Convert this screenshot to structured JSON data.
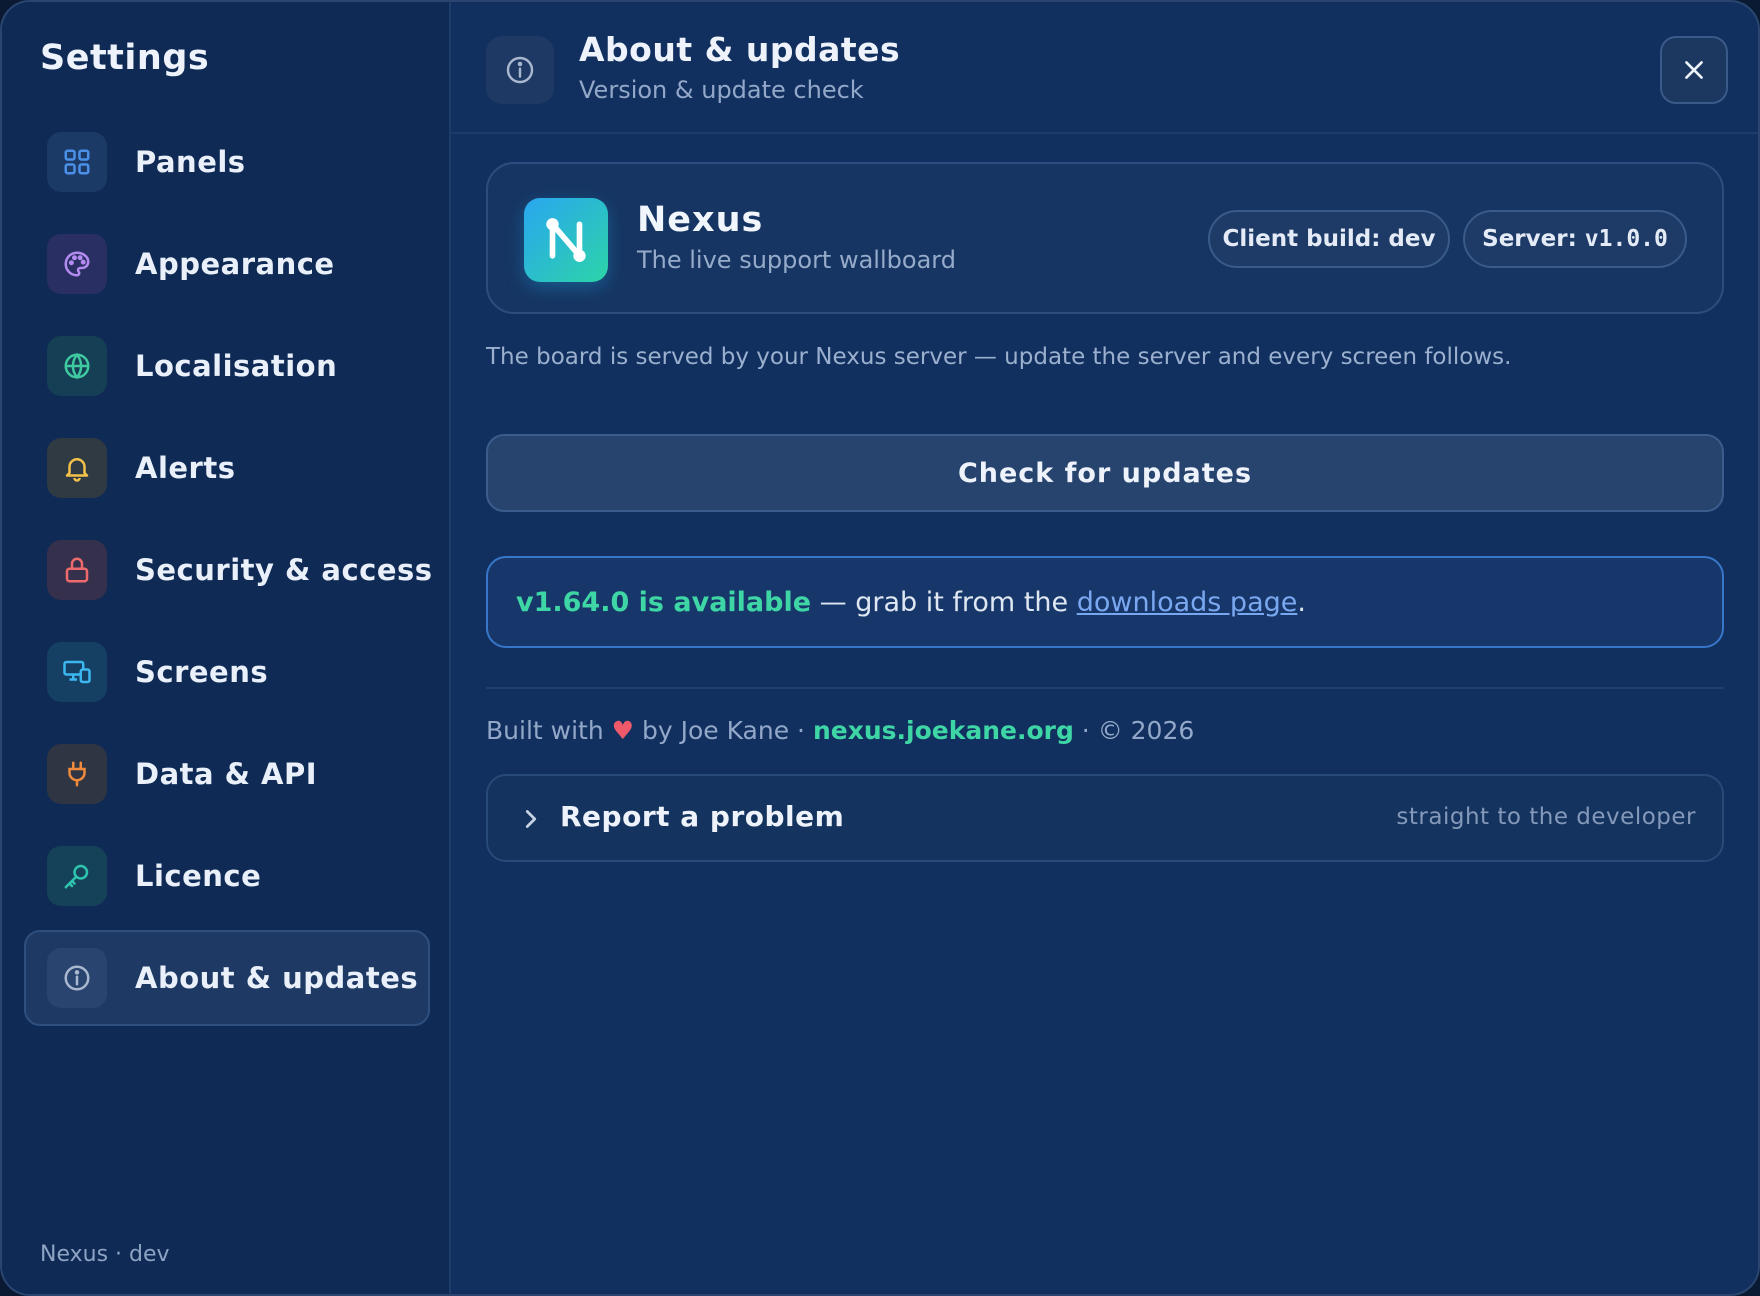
{
  "sidebar": {
    "title": "Settings",
    "items": [
      {
        "label": "Panels",
        "icon": "grid-icon",
        "color": "#4a8fe8",
        "bg": "#1c3a66"
      },
      {
        "label": "Appearance",
        "icon": "palette-icon",
        "color": "#b38bf0",
        "bg": "#2a2f63"
      },
      {
        "label": "Localisation",
        "icon": "globe-icon",
        "color": "#3fc9a0",
        "bg": "#153f55"
      },
      {
        "label": "Alerts",
        "icon": "bell-icon",
        "color": "#f2c14a",
        "bg": "#2f3a42"
      },
      {
        "label": "Security & access",
        "icon": "lock-icon",
        "color": "#ef6b6b",
        "bg": "#35304c"
      },
      {
        "label": "Screens",
        "icon": "devices-icon",
        "color": "#3cb8ef",
        "bg": "#153f63"
      },
      {
        "label": "Data & API",
        "icon": "plug-icon",
        "color": "#f08a3c",
        "bg": "#2f3542"
      },
      {
        "label": "Licence",
        "icon": "key-icon",
        "color": "#2fc4ad",
        "bg": "#154258"
      },
      {
        "label": "About & updates",
        "icon": "info-icon",
        "color": "#a9b8cf",
        "bg": "#2a4470",
        "active": true
      }
    ],
    "footer": "Nexus · dev"
  },
  "header": {
    "title": "About & updates",
    "subtitle": "Version & update check"
  },
  "app": {
    "name": "Nexus",
    "tagline": "The live support wallboard",
    "client_label": "Client build:",
    "client_value": "dev",
    "server_label": "Server:",
    "server_value": "v1.0.0"
  },
  "info_text": "The board is served by your Nexus server — update the server and every screen follows.",
  "check_button": "Check for updates",
  "update": {
    "version_text": "v1.64.0 is available",
    "middle_text": " — grab it from the ",
    "link_text": "downloads page",
    "end_text": "."
  },
  "credits": {
    "prefix": "Built with ",
    "heart": "♥",
    "by": " by Joe Kane · ",
    "site": "nexus.joekane.org",
    "suffix": " · © 2026"
  },
  "report": {
    "title": "Report a problem",
    "hint": "straight to the developer"
  },
  "colors": {
    "accent_green": "#3fd6a6",
    "link_blue": "#7aa8f0",
    "window_bg": "#11305f"
  }
}
